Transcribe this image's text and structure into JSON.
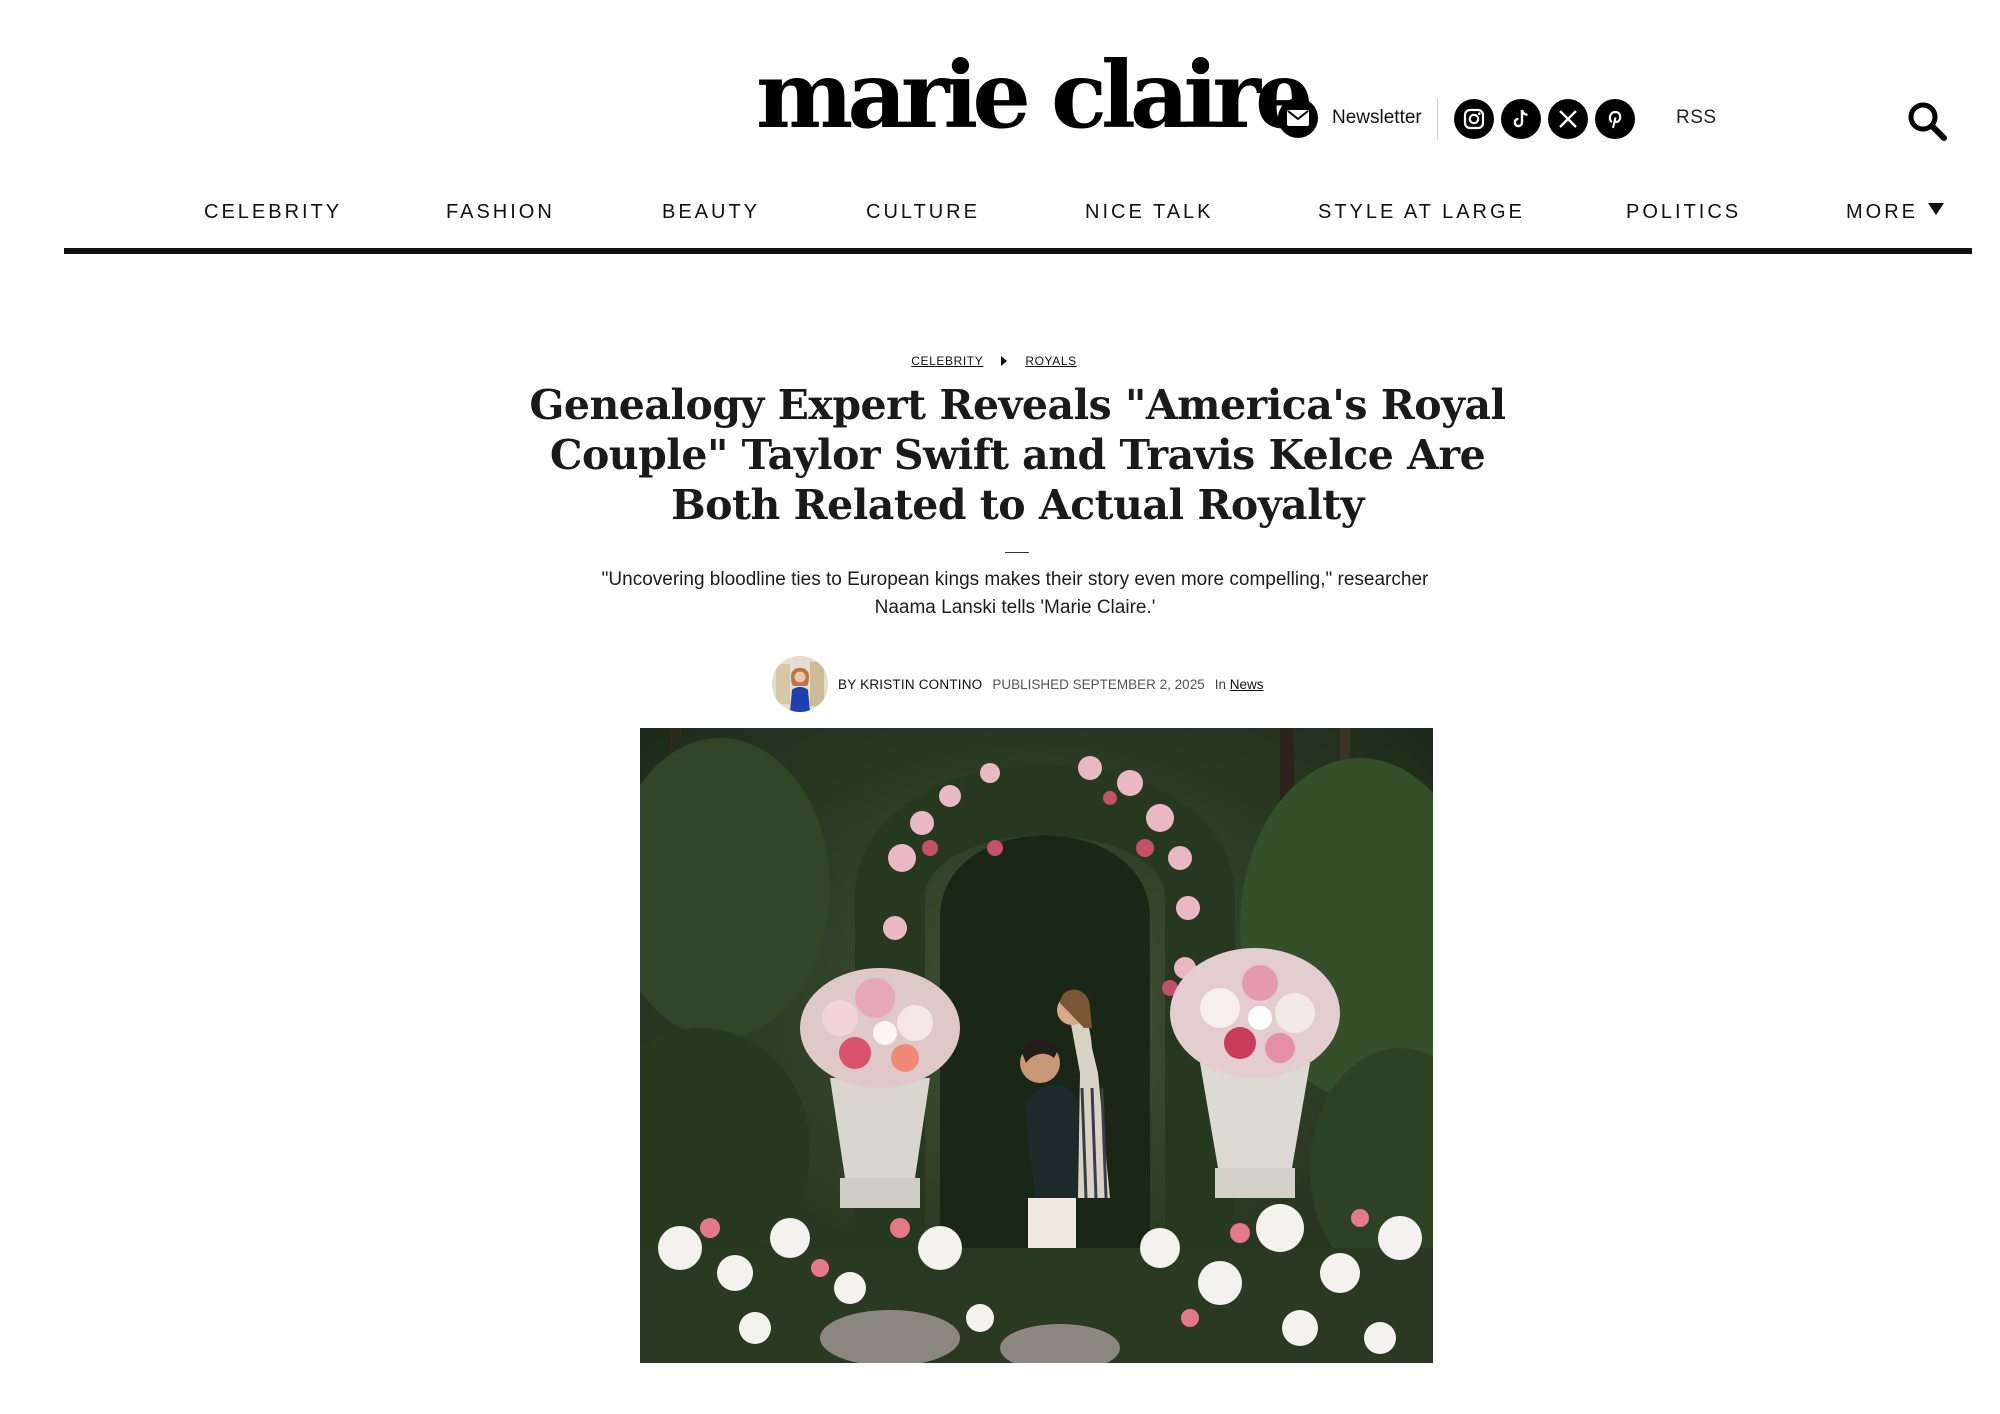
{
  "header": {
    "logo": "marie claire",
    "newsletter_label": "Newsletter",
    "social_icons": [
      "instagram-icon",
      "tiktok-icon",
      "x-icon",
      "pinterest-icon"
    ],
    "rss_label": "RSS"
  },
  "nav": {
    "items": [
      "CELEBRITY",
      "FASHION",
      "BEAUTY",
      "CULTURE",
      "NICE TALK",
      "STYLE AT LARGE",
      "POLITICS",
      "MORE"
    ]
  },
  "article": {
    "breadcrumb": [
      "CELEBRITY",
      "ROYALS"
    ],
    "headline": "Genealogy Expert Reveals \"America's Royal Couple\" Taylor Swift and Travis Kelce Are Both Related to Actual Royalty",
    "dek": "\"Uncovering bloodline ties to European kings makes their story even more compelling,\" researcher Naama Lanski tells 'Marie Claire.'",
    "byline": {
      "author": "BY KRISTIN CONTINO",
      "published": "PUBLISHED SEPTEMBER 2, 2025",
      "in_label": "In",
      "section": "News"
    }
  },
  "colors": {
    "text": "#111111",
    "rule": "#111111",
    "icon_bg": "#000000"
  }
}
